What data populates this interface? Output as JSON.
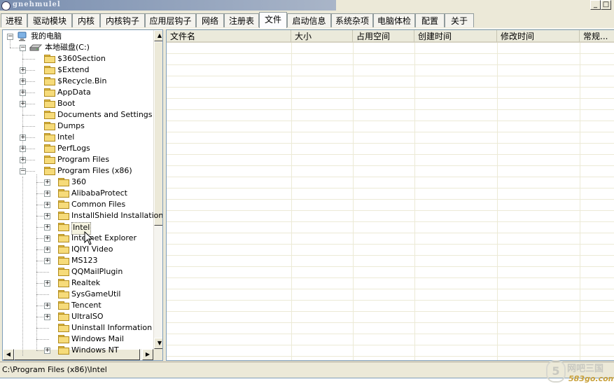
{
  "window": {
    "title": "gnehmulel",
    "minimize": "_",
    "maximize": "□"
  },
  "tabs": [
    "进程",
    "驱动模块",
    "内核",
    "内核钩子",
    "应用层钩子",
    "网络",
    "注册表",
    "文件",
    "启动信息",
    "系统杂项",
    "电脑体检",
    "配置",
    "关于"
  ],
  "active_tab": "文件",
  "tree": {
    "root": {
      "label": "我的电脑",
      "expander": "−"
    },
    "drive": {
      "label": "本地磁盘(C:)",
      "expander": "−"
    },
    "level1": [
      {
        "label": "$360Section",
        "expander": ""
      },
      {
        "label": "$Extend",
        "expander": "+"
      },
      {
        "label": "$Recycle.Bin",
        "expander": "+"
      },
      {
        "label": "AppData",
        "expander": "+"
      },
      {
        "label": "Boot",
        "expander": "+"
      },
      {
        "label": "Documents and Settings",
        "expander": ""
      },
      {
        "label": "Dumps",
        "expander": ""
      },
      {
        "label": "Intel",
        "expander": "+"
      },
      {
        "label": "PerfLogs",
        "expander": "+"
      },
      {
        "label": "Program Files",
        "expander": "+"
      },
      {
        "label": "Program Files (x86)",
        "expander": "−"
      }
    ],
    "level2": [
      {
        "label": "360",
        "expander": "+"
      },
      {
        "label": "AlibabaProtect",
        "expander": "+"
      },
      {
        "label": "Common Files",
        "expander": "+"
      },
      {
        "label": "InstallShield Installation",
        "expander": "+"
      },
      {
        "label": "Intel",
        "expander": "+",
        "selected": true
      },
      {
        "label": "Internet Explorer",
        "expander": "+"
      },
      {
        "label": "IQIYI Video",
        "expander": "+"
      },
      {
        "label": "MS123",
        "expander": "+"
      },
      {
        "label": "QQMailPlugin",
        "expander": ""
      },
      {
        "label": "Realtek",
        "expander": "+"
      },
      {
        "label": "SysGameUtil",
        "expander": ""
      },
      {
        "label": "Tencent",
        "expander": "+"
      },
      {
        "label": "UltraISO",
        "expander": "+"
      },
      {
        "label": "Uninstall Information",
        "expander": ""
      },
      {
        "label": "Windows Mail",
        "expander": ""
      },
      {
        "label": "Windows NT",
        "expander": "+"
      }
    ]
  },
  "list_columns": [
    "文件名",
    "大小",
    "占用空间",
    "创建时间",
    "修改时间",
    "常规..."
  ],
  "status_path": "C:\\Program Files (x86)\\Intel",
  "watermark": {
    "badge": "5",
    "line1": "网吧三国",
    "line2": "583go.com"
  }
}
